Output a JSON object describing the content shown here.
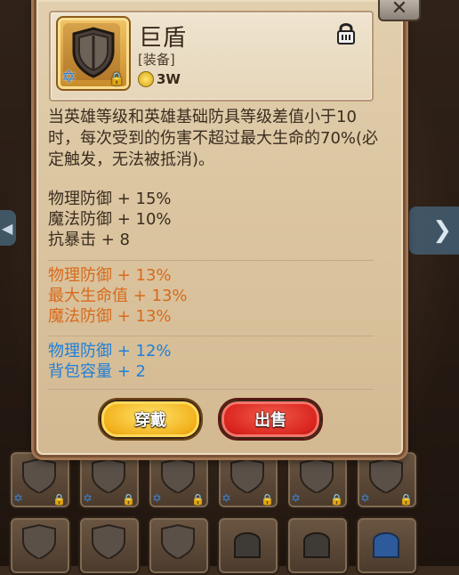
{
  "item": {
    "name": "巨盾",
    "type": "[装备]",
    "price": "3W",
    "description": "当英雄等级和英雄基础防具等级差值小于10时，每次受到的伤害不超过最大生命的70%(必定触发，无法被抵消)。"
  },
  "stats_base": [
    "物理防御 + 15%",
    "魔法防御 + 10%",
    "抗暴击 + 8"
  ],
  "stats_orange": [
    "物理防御 + 13%",
    "最大生命值 + 13%",
    "魔法防御 + 13%"
  ],
  "stats_blue": [
    "物理防御 + 12%",
    "背包容量 + 2"
  ],
  "buttons": {
    "equip": "穿戴",
    "sell": "出售"
  },
  "colors": {
    "orange": "#d86a1c",
    "blue": "#1f7fd8",
    "equip": "#f2b11c",
    "sell": "#d9241e"
  },
  "icons": [
    "shield-icon",
    "star-of-david-icon",
    "lock-icon",
    "coin-icon",
    "close-icon"
  ]
}
